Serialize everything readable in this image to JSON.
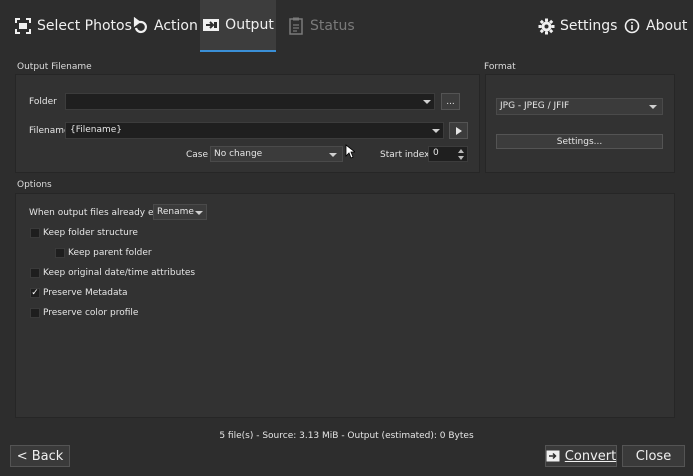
{
  "toolbar": {
    "select_photos": "Select Photos",
    "action": "Action",
    "output": "Output",
    "status": "Status",
    "settings": "Settings",
    "about": "About"
  },
  "output_filename": {
    "title": "Output Filename",
    "folder_label": "Folder",
    "folder_value": "",
    "browse_label": "...",
    "filename_label": "Filename",
    "filename_value": "{Filename}",
    "case_label": "Case",
    "case_value": "No change",
    "start_index_label": "Start index",
    "start_index_value": "0"
  },
  "format": {
    "title": "Format",
    "selected": "JPG - JPEG / JFIF",
    "settings_label": "Settings..."
  },
  "options": {
    "title": "Options",
    "exists_label": "When output files already exist",
    "exists_value": "Rename",
    "items": [
      {
        "label": "Keep folder structure",
        "checked": false
      },
      {
        "label": "Keep parent folder",
        "checked": false
      },
      {
        "label": "Keep original date/time attributes",
        "checked": false
      },
      {
        "label": "Preserve Metadata",
        "checked": true
      },
      {
        "label": "Preserve color profile",
        "checked": false
      }
    ]
  },
  "status_bar": "5 file(s) - Source: 3.13 MiB - Output (estimated): 0 Bytes",
  "buttons": {
    "back": "< Back",
    "convert": "Convert",
    "close": "Close"
  },
  "colors": {
    "accent": "#3a8fd6",
    "background": "#2d2d2d",
    "panel": "#323232"
  }
}
